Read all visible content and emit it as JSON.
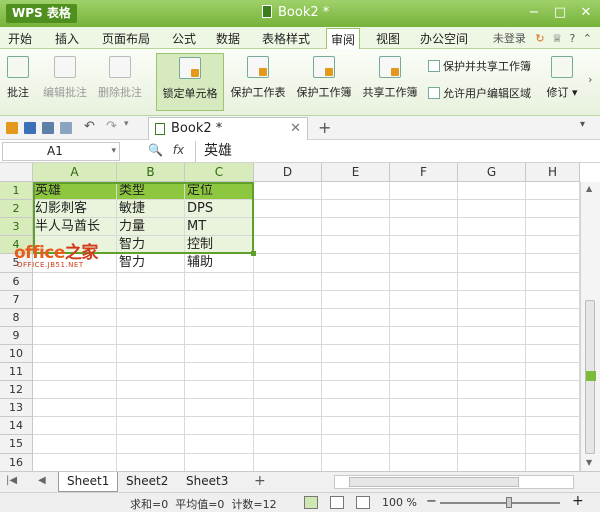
{
  "app": {
    "name": "WPS 表格",
    "doc_title": "Book2 *"
  },
  "menus": [
    "开始",
    "插入",
    "页面布局",
    "公式",
    "数据",
    "表格样式",
    "审阅",
    "视图",
    "办公空间"
  ],
  "active_menu": "审阅",
  "menu_right": {
    "login": "未登录"
  },
  "ribbon": {
    "comment": "批注",
    "edit_comment": "编辑批注",
    "delete_comment": "删除批注",
    "lock_cell": "锁定单元格",
    "protect_sheet": "保护工作表",
    "protect_book": "保护工作簿",
    "share_book": "共享工作簿",
    "protect_share": "保护并共享工作簿",
    "allow_edit": "允许用户编辑区域",
    "revise": "修订"
  },
  "doc_tab": "Book2 *",
  "namebox": "A1",
  "formula_value": "英雄",
  "columns": [
    "A",
    "B",
    "C",
    "D",
    "E",
    "F",
    "G",
    "H"
  ],
  "rows": [
    "1",
    "2",
    "3",
    "4",
    "5",
    "6",
    "7",
    "8",
    "9",
    "10",
    "11",
    "12",
    "13",
    "14",
    "15",
    "16"
  ],
  "cells": {
    "r1": [
      "英雄",
      "类型",
      "定位"
    ],
    "r2": [
      "幻影刺客",
      "敏捷",
      "DPS"
    ],
    "r3": [
      "半人马酋长",
      "力量",
      "MT"
    ],
    "r4": [
      "",
      "智力",
      "控制"
    ],
    "r5": [
      "",
      "智力",
      "辅助"
    ]
  },
  "watermark": {
    "main": "office",
    "cn": "之家",
    "sub": "OFFICE.JB51.NET"
  },
  "sheets": [
    "Sheet1",
    "Sheet2",
    "Sheet3"
  ],
  "active_sheet": "Sheet1",
  "status": {
    "sum": "求和=0",
    "avg": "平均值=0",
    "count": "计数=12",
    "zoom": "100 %"
  },
  "colors": {
    "accent": "#76b33a",
    "selection_header": "#d7ebbb",
    "highlight_fill": "#8dc63f",
    "watermark": "#e85b1b"
  }
}
